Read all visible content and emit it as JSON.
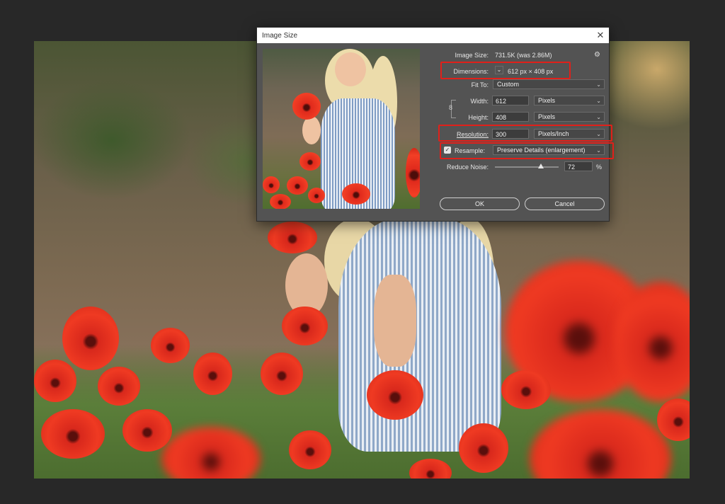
{
  "dialog": {
    "title": "Image Size",
    "close_symbol": "✕",
    "image_size_label": "Image Size:",
    "image_size_value": "731.5K (was 2.86M)",
    "dimensions_label": "Dimensions:",
    "dimensions_value": "612 px  ×  408 px",
    "fit_to_label": "Fit To:",
    "fit_to_value": "Custom",
    "width_label": "Width:",
    "width_value": "612",
    "width_unit": "Pixels",
    "height_label": "Height:",
    "height_value": "408",
    "height_unit": "Pixels",
    "resolution_label": "Resolution:",
    "resolution_value": "300",
    "resolution_unit": "Pixels/Inch",
    "resample_label": "Resample:",
    "resample_checked": true,
    "resample_value": "Preserve Details (enlargement)",
    "reduce_noise_label": "Reduce Noise:",
    "reduce_noise_value": "72",
    "reduce_noise_unit": "%",
    "reduce_noise_fraction": 0.72,
    "ok_label": "OK",
    "cancel_label": "Cancel"
  },
  "icons": {
    "gear": "⚙",
    "caret": "⌄",
    "check": "✓",
    "link": "8"
  },
  "colors": {
    "highlight": "#e0201a",
    "dialog_bg": "#535353",
    "app_bg": "#282828"
  }
}
